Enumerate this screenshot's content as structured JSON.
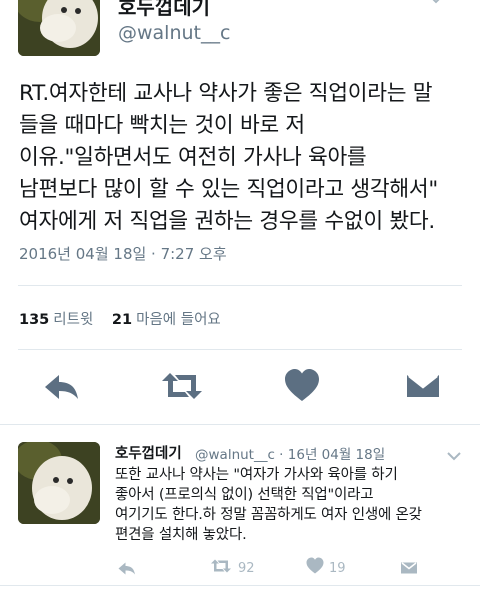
{
  "tweet": {
    "display_name": "호두껍데기",
    "handle": "@walnut__c",
    "text": "RT.여자한테 교사나 약사가 좋은 직업이라는 말\n들을 때마다 빡치는 것이 바로 저\n이유.\"일하면서도 여전히 가사나 육아를\n남편보다 많이 할 수 있는 직업이라고 생각해서\"\n여자에게 저 직업을 권하는 경우를 수없이 봤다.",
    "timestamp": "2016년 04월 18일 · 7:27 오후",
    "retweet_count": "135",
    "retweet_label": "리트윗",
    "like_count": "21",
    "like_label": "마음에 들어요"
  },
  "icons": {
    "reply": "reply-icon",
    "retweet": "retweet-icon",
    "like": "heart-icon",
    "message": "message-icon",
    "more": "chevron-down-icon"
  },
  "reply_tweet": {
    "display_name": "호두껍데기",
    "meta": "@walnut__c · 16년 04월 18일",
    "text": "또한 교사나 약사는 \"여자가 가사와 육아를 하기\n좋아서 (프로의식 없이) 선택한 직업\"이라고\n여기기도 한다.하 정말 꼼꼼하게도 여자 인생에 온갖\n편견을 설치해 놓았다.",
    "retweet_count": "92",
    "like_count": "19"
  },
  "colors": {
    "text": "#14171a",
    "secondary": "#657786",
    "icon": "#5c6f82",
    "icon_light": "#aab8c2",
    "divider": "#e1e8ed"
  }
}
